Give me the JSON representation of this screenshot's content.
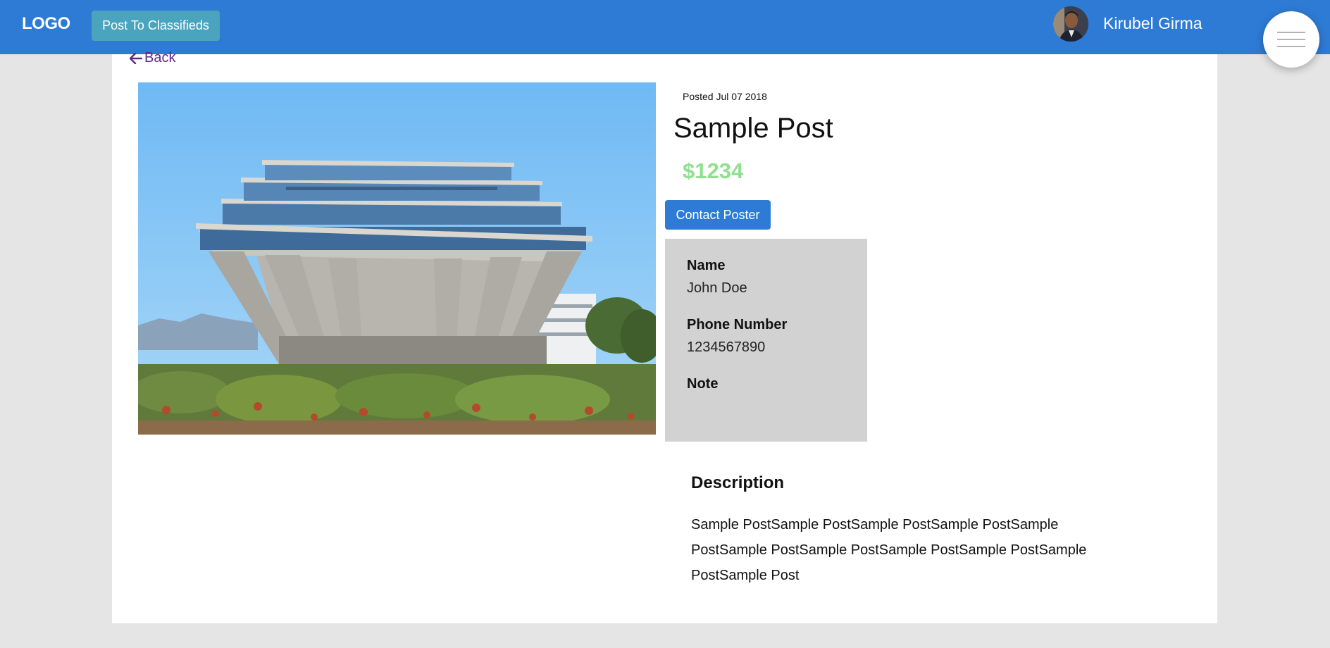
{
  "header": {
    "logo": "LOGO",
    "post_button": "Post To Classifieds",
    "user_name": "Kirubel Girma",
    "menu_icon": "hamburger-menu-icon",
    "bg_color": "#2e7bd5"
  },
  "nav": {
    "back_label": "Back",
    "back_icon": "arrow-left-icon"
  },
  "post": {
    "posted": "Posted Jul 07 2018",
    "title": "Sample Post",
    "price": "$1234",
    "price_color": "#8fe08f",
    "image_desc": "photo of a large concrete brutalist library building against blue sky",
    "contact_button": "Contact Poster",
    "contact": {
      "name_label": "Name",
      "name_value": "John Doe",
      "phone_label": "Phone Number",
      "phone_value": "1234567890",
      "note_label": "Note",
      "note_value": ""
    },
    "description_heading": "Description",
    "description": "Sample PostSample PostSample PostSample PostSample PostSample PostSample PostSample PostSample PostSample PostSample Post"
  }
}
